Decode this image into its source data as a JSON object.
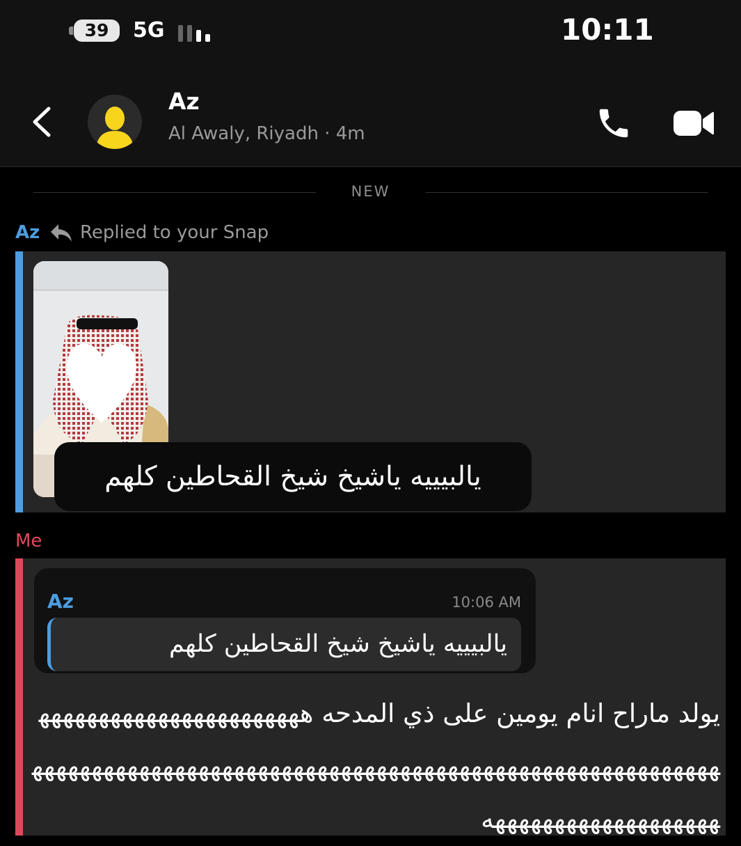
{
  "status_bar": {
    "battery": "39",
    "network": "5G",
    "time": "10:11",
    "icons": [
      "battery-icon",
      "signal-icon"
    ]
  },
  "header": {
    "contact_name": "Az",
    "contact_subtitle": "Al Awaly, Riyadh · 4m",
    "icons": [
      "back-icon",
      "avatar-icon",
      "phone-icon",
      "video-camera-icon"
    ]
  },
  "chat": {
    "divider_label": "NEW",
    "messages": [
      {
        "sender": "Az",
        "context": "Replied to your Snap",
        "snap_caption": "يالبيييه ياشيخ شيخ القحاطين كلهم"
      },
      {
        "sender": "Me",
        "quote": {
          "sender": "Az",
          "time": "10:06 AM",
          "text": "يالبيييه ياشيخ شيخ القحاطين كلهم"
        },
        "body": "يولد ماراح انام يومين على ذي المدحه ههههههههههههههههههههههههههههههههههههههههههههههههههههههههههههههههههههههههههههههههههههههههههههههههههههه"
      }
    ]
  },
  "colors": {
    "az_accent": "#4d9de0",
    "me_accent": "#e0475b",
    "bubble_bg": "#262626",
    "header_bg": "#121212"
  }
}
